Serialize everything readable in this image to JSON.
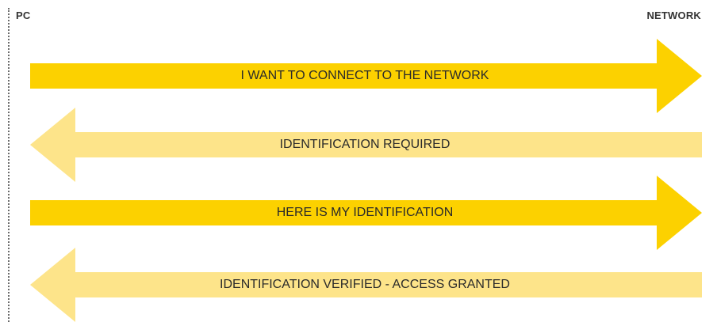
{
  "endpoints": {
    "left": "PC",
    "right": "NETWORK"
  },
  "colors": {
    "request": "#fcd100",
    "response": "#fde48a",
    "text": "#2a2a2a"
  },
  "messages": [
    {
      "text": "I WANT TO CONNECT TO THE NETWORK",
      "direction": "right"
    },
    {
      "text": "IDENTIFICATION REQUIRED",
      "direction": "left"
    },
    {
      "text": "HERE IS MY IDENTIFICATION",
      "direction": "right"
    },
    {
      "text": "IDENTIFICATION VERIFIED - ACCESS GRANTED",
      "direction": "left"
    }
  ]
}
